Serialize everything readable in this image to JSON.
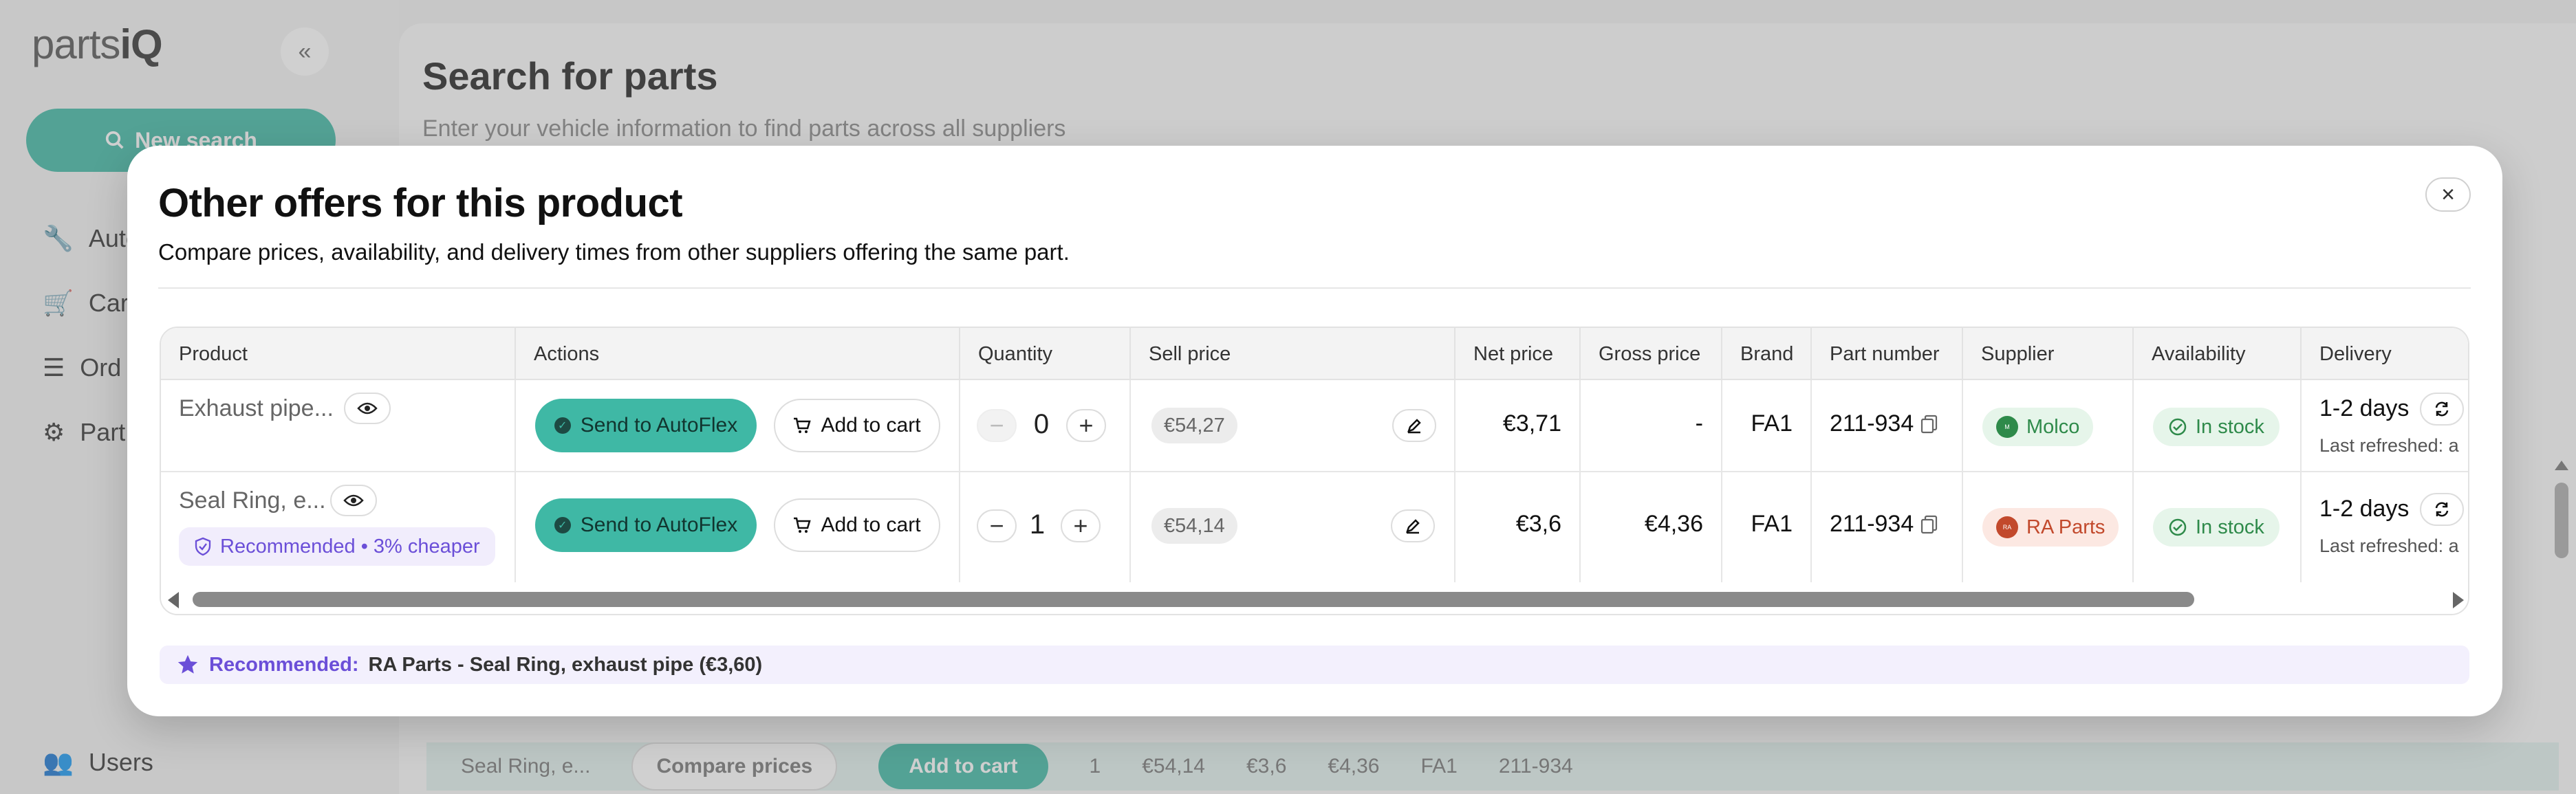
{
  "background": {
    "logo": {
      "text": "parts",
      "bold": "iQ"
    },
    "collapse_icon": "«",
    "new_search_label": "New search",
    "nav_items": [
      {
        "label": "Auto",
        "icon": "wrench-icon"
      },
      {
        "label": "Cart",
        "icon": "cart-icon"
      },
      {
        "label": "Ord",
        "icon": "list-icon"
      },
      {
        "label": "Part",
        "icon": "gear-icon"
      },
      {
        "label": "Users",
        "icon": "users-icon"
      }
    ],
    "page_title": "Search for parts",
    "page_subtitle": "Enter your vehicle information to find parts across all suppliers",
    "bg_row": {
      "product": "Seal Ring, e...",
      "compare": "Compare prices",
      "add_to_cart": "Add to cart",
      "qty": "1",
      "sell": "€54,14",
      "net": "€3,6",
      "gross": "€4,36",
      "brand": "FA1",
      "part": "211-934"
    }
  },
  "modal": {
    "title": "Other offers for this product",
    "description": "Compare prices, availability, and delivery times from other suppliers offering the same part.",
    "close_icon": "×",
    "columns": [
      "Product",
      "Actions",
      "Quantity",
      "Sell price",
      "Net price",
      "Gross price",
      "Brand",
      "Part number",
      "Supplier",
      "Availability",
      "Delivery"
    ],
    "rows": [
      {
        "product": "Exhaust pipe...",
        "send_label": "Send to AutoFlex",
        "cart_label": "Add to cart",
        "quantity": "0",
        "sell_price": "€54,27",
        "net_price": "€3,71",
        "gross_price": "-",
        "brand": "FA1",
        "part_number": "211-934",
        "supplier": "Molco",
        "availability": "In stock",
        "delivery": "1-2 days",
        "last_refreshed": "Last refreshed: a"
      },
      {
        "product": "Seal Ring, e...",
        "recommended_badge": "Recommended • 3% cheaper",
        "send_label": "Send to AutoFlex",
        "cart_label": "Add to cart",
        "quantity": "1",
        "sell_price": "€54,14",
        "net_price": "€3,6",
        "gross_price": "€4,36",
        "brand": "FA1",
        "part_number": "211-934",
        "supplier": "RA Parts",
        "availability": "In stock",
        "delivery": "1-2 days",
        "last_refreshed": "Last refreshed: a"
      }
    ],
    "recommendation": {
      "label": "Recommended:",
      "text": "RA Parts - Seal Ring, exhaust pipe (€3,60)"
    }
  },
  "colors": {
    "accent": "#3fb8a5",
    "recommend": "#6b4fd8",
    "stock_green": "#2e8a4a",
    "ra_red": "#c2492c"
  }
}
